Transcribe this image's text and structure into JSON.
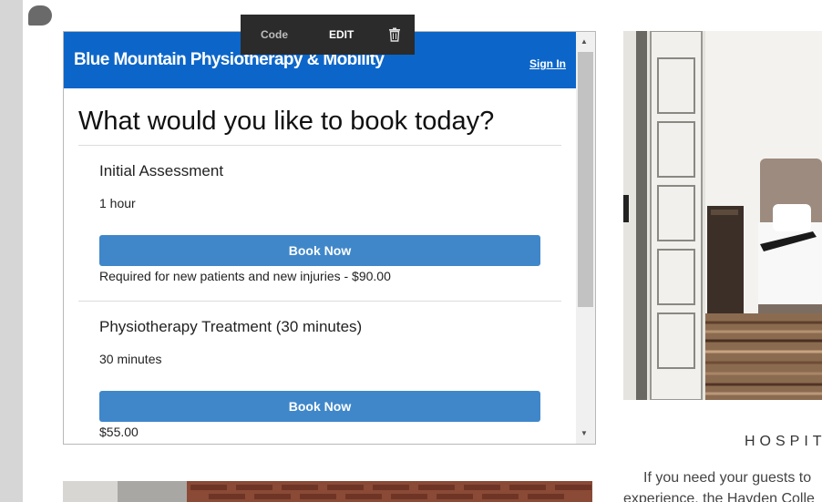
{
  "editor_toolbar": {
    "code_label": "Code",
    "edit_label": "EDIT",
    "trash_icon": "trash-icon"
  },
  "booking_widget": {
    "brand_name": "Blue Mountain Physiotherapy & Mobility",
    "sign_in_label": "Sign In",
    "heading": "What would you like to book today?",
    "header_color": "#0c66c9",
    "button_color": "#3f87c9",
    "services": [
      {
        "name": "Initial Assessment",
        "duration": "1 hour",
        "button_label": "Book Now",
        "note": "Required for new patients and new injuries - $90.00"
      },
      {
        "name": "Physiotherapy Treatment (30 minutes)",
        "duration": "30 minutes",
        "button_label": "Book Now",
        "note": "$55.00"
      }
    ]
  },
  "right_column": {
    "section_label": "HOSPITA",
    "body_line_1": "If you need your guests to",
    "body_line_2": "experience, the Hayden Colle"
  }
}
